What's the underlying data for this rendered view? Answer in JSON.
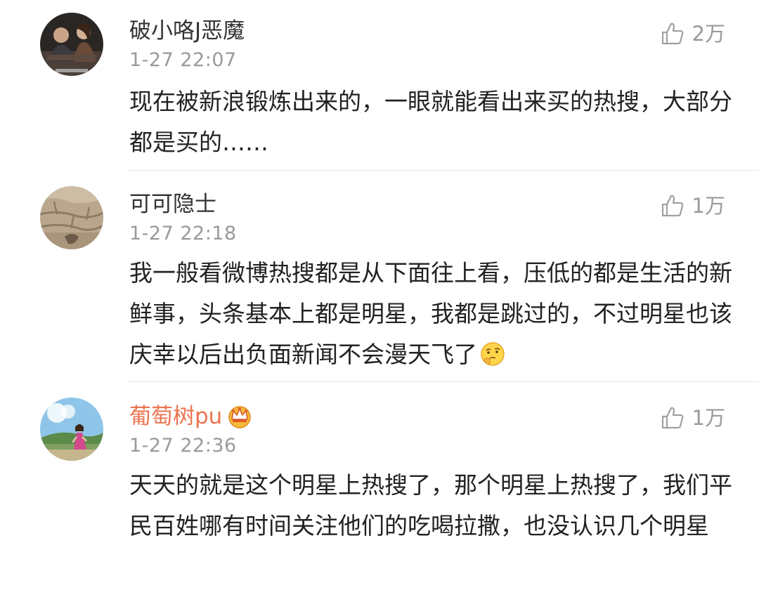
{
  "comments": [
    {
      "username": "破小咯J恶魔",
      "timestamp": "1-27 22:07",
      "likes": "2万",
      "text": "现在被新浪锻炼出来的，一眼就能看出来买的热搜，大部分都是买的……",
      "avatar_icon": "avatar-photo-people"
    },
    {
      "username": "可可隐士",
      "timestamp": "1-27 22:18",
      "likes": "1万",
      "text": "我一般看微博热搜都是从下面往上看，压低的都是生活的新鲜事，头条基本上都是明星，我都是跳过的，不过明星也该庆幸以后出负面新闻不会漫天飞了",
      "emoji_icon": "thinking-face-emoji",
      "avatar_icon": "avatar-photo-stone-wall"
    },
    {
      "username": "葡萄树pu",
      "timestamp": "1-27 22:36",
      "likes": "1万",
      "text": "天天的就是这个明星上热搜了，那个明星上热搜了，我们平民百姓哪有时间关注他们的吃喝拉撒，也没认识几个明星",
      "badge_icon": "vip-crown-icon",
      "avatar_icon": "avatar-photo-girl-landscape"
    }
  ],
  "colors": {
    "vip_name": "#eb7350",
    "normal_name": "#333333",
    "meta_gray": "#9a9a9a",
    "divider": "#e6e6e6"
  }
}
